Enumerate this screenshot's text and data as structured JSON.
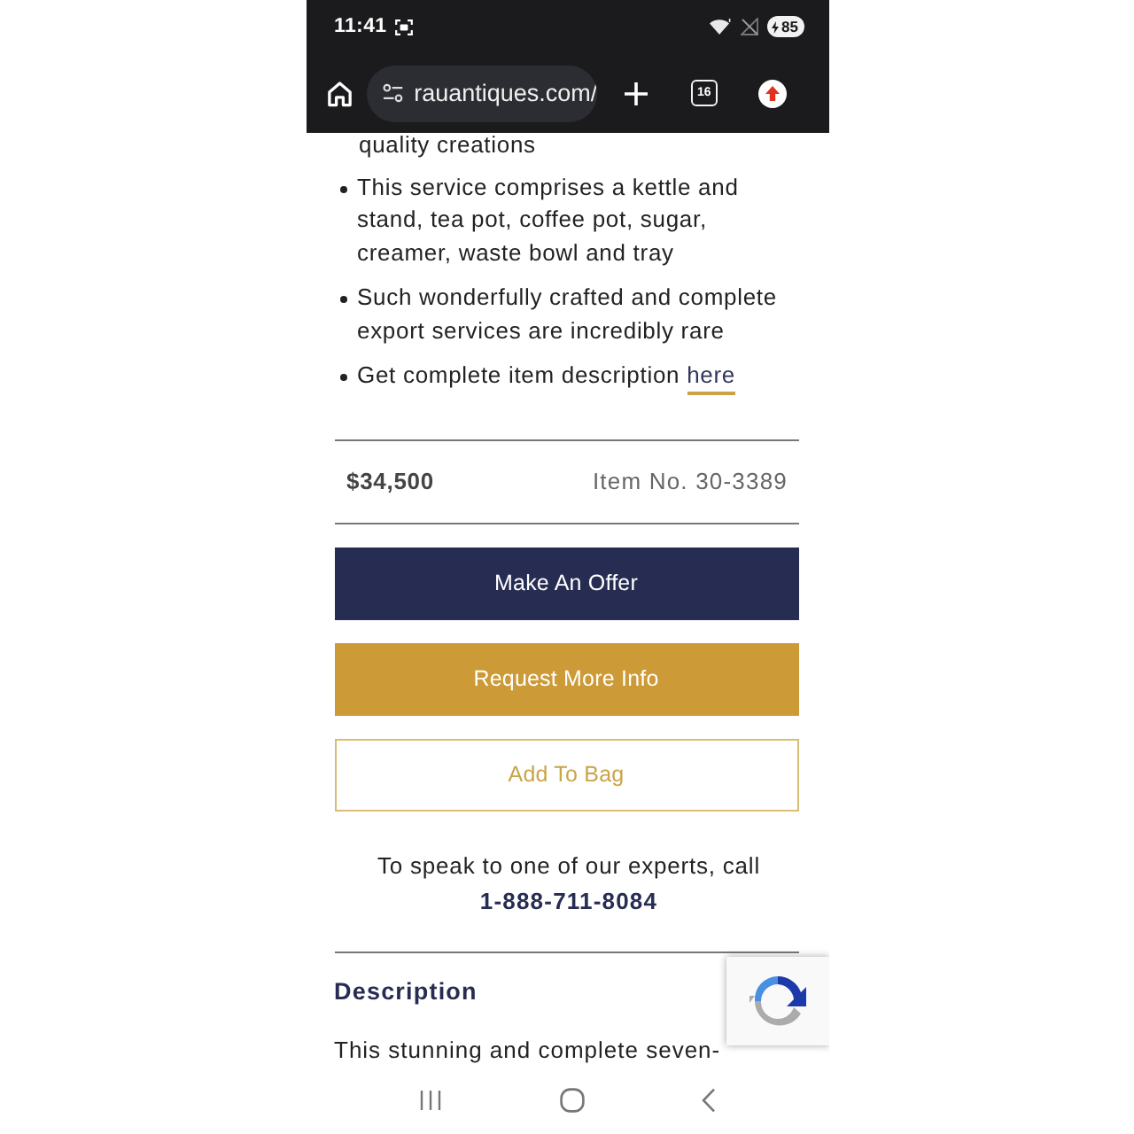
{
  "status_bar": {
    "time": "11:41",
    "battery": "85"
  },
  "browser_bar": {
    "url": "rauantiques.com/",
    "tab_count": "16"
  },
  "features": {
    "continued_line": "quality creations",
    "items": [
      {
        "text": "This service comprises a kettle and stand, tea pot, coffee pot, sugar, creamer, waste bowl and tray"
      },
      {
        "text": "Such wonderfully crafted and complete export services are incredibly rare"
      },
      {
        "text": "Get complete item description",
        "link": "here"
      }
    ]
  },
  "price_row": {
    "price": "$34,500",
    "item_number": "Item No. 30-3389"
  },
  "buttons": [
    {
      "label": "Make An Offer",
      "kind": "primary"
    },
    {
      "label": "Request More Info",
      "kind": "secondary"
    },
    {
      "label": "Add To Bag",
      "kind": "outline"
    }
  ],
  "contact": {
    "text": "To speak to one of our experts, call",
    "phone": "1-888-711-8084"
  },
  "description": {
    "heading": "Description",
    "text": "This stunning and complete seven-"
  }
}
